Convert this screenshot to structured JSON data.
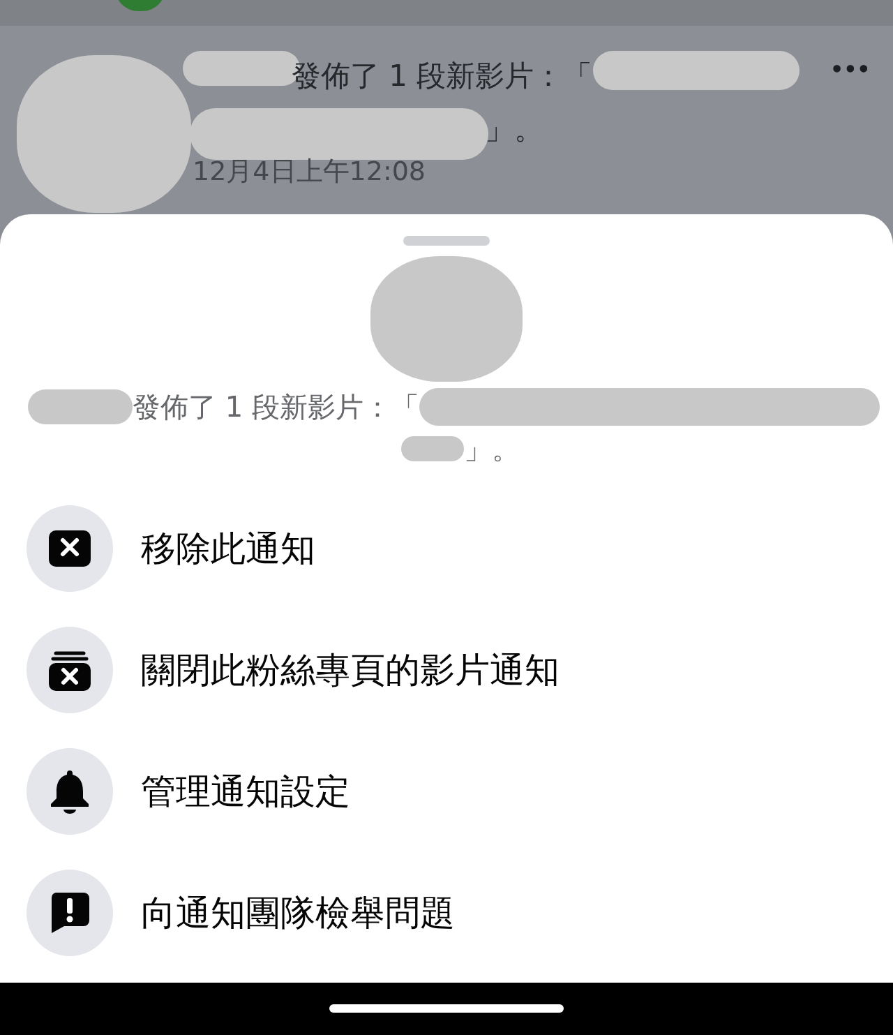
{
  "background_notification": {
    "text_line_1": "發佈了 1 段新影片：「",
    "text_line_2": "」。",
    "time": "12月4日上午12:08",
    "more_button": "•••"
  },
  "sheet": {
    "text_line_1": "發佈了 1 段新影片：「",
    "text_line_2": "」。",
    "actions": [
      {
        "kind": "remove",
        "label": "移除此通知"
      },
      {
        "kind": "mute",
        "label": "關閉此粉絲專頁的影片通知"
      },
      {
        "kind": "settings",
        "label": "管理通知設定"
      },
      {
        "kind": "report",
        "label": "向通知團隊檢舉問題"
      }
    ]
  }
}
